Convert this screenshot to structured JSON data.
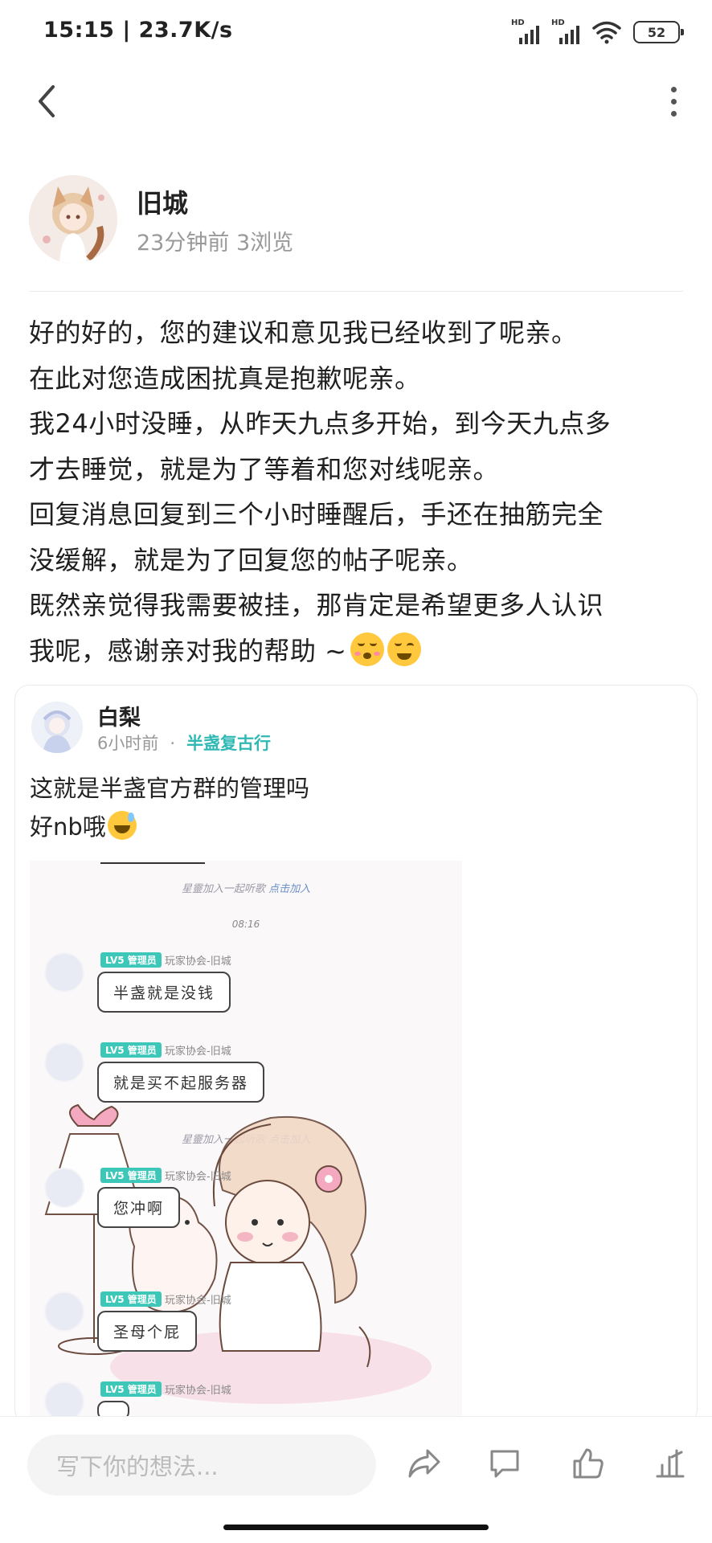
{
  "status_bar": {
    "time_speed": "15:15 | 23.7K/s",
    "signal_label_1": "HD",
    "signal_label_2": "HD",
    "battery": "52"
  },
  "nav": {
    "back_icon": "chevron-left-icon",
    "more_icon": "more-vertical-icon"
  },
  "post": {
    "author": "旧城",
    "meta": "23分钟前  3浏览",
    "lines": [
      "好的好的，您的建议和意见我已经收到了呢亲。",
      "在此对您造成困扰真是抱歉呢亲。",
      "我24小时没睡，从昨天九点多开始，到今天九点多",
      "才去睡觉，就是为了等着和您对线呢亲。",
      "回复消息回复到三个小时睡醒后，手还在抽筋完全",
      "没缓解，就是为了回复您的帖子呢亲。",
      "既然亲觉得我需要被挂，那肯定是希望更多人认识",
      "我呢，感谢亲对我的帮助 ~"
    ],
    "end_emojis": [
      "kissing-face-emoji",
      "winking-face-emoji"
    ]
  },
  "quote": {
    "author": "白梨",
    "time": "6小时前",
    "separator": "·",
    "circle": "半盏复古行",
    "line1": "这就是半盏官方群的管理吗",
    "line2": "好nb哦",
    "line2_emoji": "sweat-smile-emoji",
    "screenshot": {
      "join_prefix": "星靈加入一起听歌",
      "join_link": "点击加入",
      "time": "08:16",
      "messages": [
        {
          "tag": "LV5 管理员",
          "who": "玩家协会-旧城",
          "text": "半盏就是没钱"
        },
        {
          "tag": "LV5 管理员",
          "who": "玩家协会-旧城",
          "text": "就是买不起服务器"
        },
        {
          "tag": "LV5 管理员",
          "who": "玩家协会-旧城",
          "text": "您冲啊"
        },
        {
          "tag": "LV5 管理员",
          "who": "玩家协会-旧城",
          "text": "圣母个屁"
        },
        {
          "tag": "LV5 管理员",
          "who": "玩家协会-旧城",
          "text": ""
        }
      ]
    }
  },
  "bottom_bar": {
    "comment_placeholder": "写下你的想法...",
    "actions": [
      "share-icon",
      "comment-icon",
      "like-icon",
      "stats-icon"
    ]
  }
}
